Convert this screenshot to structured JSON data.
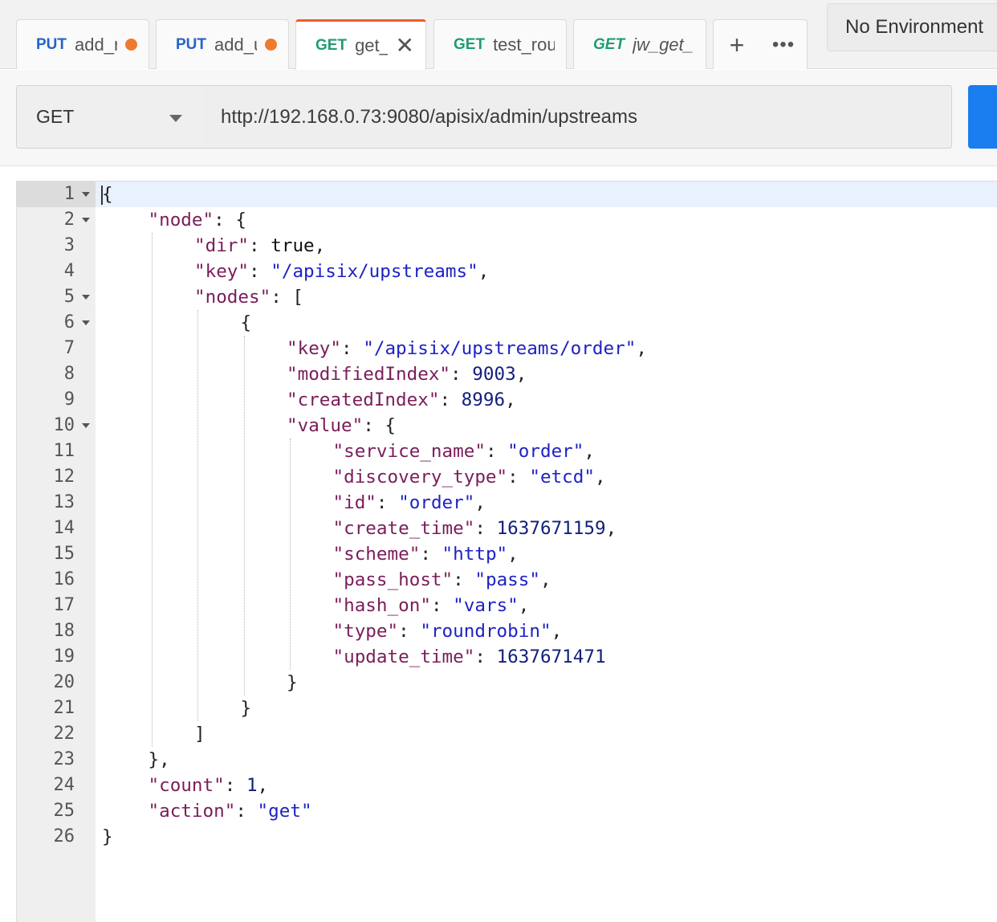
{
  "tabs": [
    {
      "method": "PUT",
      "name": "add_r",
      "unsaved": true,
      "active": false,
      "italic": false
    },
    {
      "method": "PUT",
      "name": "add_u",
      "unsaved": true,
      "active": false,
      "italic": false
    },
    {
      "method": "GET",
      "name": "get_u",
      "unsaved": false,
      "active": true,
      "italic": false
    },
    {
      "method": "GET",
      "name": "test_route",
      "unsaved": false,
      "active": false,
      "italic": false
    },
    {
      "method": "GET",
      "name": "jw_get_token",
      "unsaved": false,
      "active": false,
      "italic": true
    }
  ],
  "tab_controls": {
    "new_tab": "+",
    "more": "•••"
  },
  "environment": "No Environment",
  "request": {
    "method": "GET",
    "url": "http://192.168.0.73:9080/apisix/admin/upstreams"
  },
  "colors": {
    "accent": "#ef5b25",
    "send_button": "#1a7df0",
    "put_method": "#2563c9",
    "get_method": "#1f9d6e",
    "unsaved_dot": "#ef7a2e"
  },
  "editor": {
    "active_line": 1,
    "lines": [
      {
        "no": "1",
        "fold": true,
        "indent": 0,
        "tokens": [
          {
            "t": "p",
            "v": "{"
          }
        ]
      },
      {
        "no": "2",
        "fold": true,
        "indent": 1,
        "tokens": [
          {
            "t": "k",
            "v": "\"node\""
          },
          {
            "t": "p",
            "v": ": {"
          }
        ]
      },
      {
        "no": "3",
        "fold": false,
        "indent": 2,
        "tokens": [
          {
            "t": "k",
            "v": "\"dir\""
          },
          {
            "t": "p",
            "v": ": "
          },
          {
            "t": "b",
            "v": "true"
          },
          {
            "t": "p",
            "v": ","
          }
        ]
      },
      {
        "no": "4",
        "fold": false,
        "indent": 2,
        "tokens": [
          {
            "t": "k",
            "v": "\"key\""
          },
          {
            "t": "p",
            "v": ": "
          },
          {
            "t": "s",
            "v": "\"/apisix/upstreams\""
          },
          {
            "t": "p",
            "v": ","
          }
        ]
      },
      {
        "no": "5",
        "fold": true,
        "indent": 2,
        "tokens": [
          {
            "t": "k",
            "v": "\"nodes\""
          },
          {
            "t": "p",
            "v": ": ["
          }
        ]
      },
      {
        "no": "6",
        "fold": true,
        "indent": 3,
        "tokens": [
          {
            "t": "p",
            "v": "{"
          }
        ]
      },
      {
        "no": "7",
        "fold": false,
        "indent": 4,
        "tokens": [
          {
            "t": "k",
            "v": "\"key\""
          },
          {
            "t": "p",
            "v": ": "
          },
          {
            "t": "s",
            "v": "\"/apisix/upstreams/order\""
          },
          {
            "t": "p",
            "v": ","
          }
        ]
      },
      {
        "no": "8",
        "fold": false,
        "indent": 4,
        "tokens": [
          {
            "t": "k",
            "v": "\"modifiedIndex\""
          },
          {
            "t": "p",
            "v": ": "
          },
          {
            "t": "n",
            "v": "9003"
          },
          {
            "t": "p",
            "v": ","
          }
        ]
      },
      {
        "no": "9",
        "fold": false,
        "indent": 4,
        "tokens": [
          {
            "t": "k",
            "v": "\"createdIndex\""
          },
          {
            "t": "p",
            "v": ": "
          },
          {
            "t": "n",
            "v": "8996"
          },
          {
            "t": "p",
            "v": ","
          }
        ]
      },
      {
        "no": "10",
        "fold": true,
        "indent": 4,
        "tokens": [
          {
            "t": "k",
            "v": "\"value\""
          },
          {
            "t": "p",
            "v": ": {"
          }
        ]
      },
      {
        "no": "11",
        "fold": false,
        "indent": 5,
        "tokens": [
          {
            "t": "k",
            "v": "\"service_name\""
          },
          {
            "t": "p",
            "v": ": "
          },
          {
            "t": "s",
            "v": "\"order\""
          },
          {
            "t": "p",
            "v": ","
          }
        ]
      },
      {
        "no": "12",
        "fold": false,
        "indent": 5,
        "tokens": [
          {
            "t": "k",
            "v": "\"discovery_type\""
          },
          {
            "t": "p",
            "v": ": "
          },
          {
            "t": "s",
            "v": "\"etcd\""
          },
          {
            "t": "p",
            "v": ","
          }
        ]
      },
      {
        "no": "13",
        "fold": false,
        "indent": 5,
        "tokens": [
          {
            "t": "k",
            "v": "\"id\""
          },
          {
            "t": "p",
            "v": ": "
          },
          {
            "t": "s",
            "v": "\"order\""
          },
          {
            "t": "p",
            "v": ","
          }
        ]
      },
      {
        "no": "14",
        "fold": false,
        "indent": 5,
        "tokens": [
          {
            "t": "k",
            "v": "\"create_time\""
          },
          {
            "t": "p",
            "v": ": "
          },
          {
            "t": "n",
            "v": "1637671159"
          },
          {
            "t": "p",
            "v": ","
          }
        ]
      },
      {
        "no": "15",
        "fold": false,
        "indent": 5,
        "tokens": [
          {
            "t": "k",
            "v": "\"scheme\""
          },
          {
            "t": "p",
            "v": ": "
          },
          {
            "t": "s",
            "v": "\"http\""
          },
          {
            "t": "p",
            "v": ","
          }
        ]
      },
      {
        "no": "16",
        "fold": false,
        "indent": 5,
        "tokens": [
          {
            "t": "k",
            "v": "\"pass_host\""
          },
          {
            "t": "p",
            "v": ": "
          },
          {
            "t": "s",
            "v": "\"pass\""
          },
          {
            "t": "p",
            "v": ","
          }
        ]
      },
      {
        "no": "17",
        "fold": false,
        "indent": 5,
        "tokens": [
          {
            "t": "k",
            "v": "\"hash_on\""
          },
          {
            "t": "p",
            "v": ": "
          },
          {
            "t": "s",
            "v": "\"vars\""
          },
          {
            "t": "p",
            "v": ","
          }
        ]
      },
      {
        "no": "18",
        "fold": false,
        "indent": 5,
        "tokens": [
          {
            "t": "k",
            "v": "\"type\""
          },
          {
            "t": "p",
            "v": ": "
          },
          {
            "t": "s",
            "v": "\"roundrobin\""
          },
          {
            "t": "p",
            "v": ","
          }
        ]
      },
      {
        "no": "19",
        "fold": false,
        "indent": 5,
        "tokens": [
          {
            "t": "k",
            "v": "\"update_time\""
          },
          {
            "t": "p",
            "v": ": "
          },
          {
            "t": "n",
            "v": "1637671471"
          }
        ]
      },
      {
        "no": "20",
        "fold": false,
        "indent": 4,
        "tokens": [
          {
            "t": "p",
            "v": "}"
          }
        ]
      },
      {
        "no": "21",
        "fold": false,
        "indent": 3,
        "tokens": [
          {
            "t": "p",
            "v": "}"
          }
        ]
      },
      {
        "no": "22",
        "fold": false,
        "indent": 2,
        "tokens": [
          {
            "t": "p",
            "v": "]"
          }
        ]
      },
      {
        "no": "23",
        "fold": false,
        "indent": 1,
        "tokens": [
          {
            "t": "p",
            "v": "},"
          }
        ]
      },
      {
        "no": "24",
        "fold": false,
        "indent": 1,
        "tokens": [
          {
            "t": "k",
            "v": "\"count\""
          },
          {
            "t": "p",
            "v": ": "
          },
          {
            "t": "n",
            "v": "1"
          },
          {
            "t": "p",
            "v": ","
          }
        ]
      },
      {
        "no": "25",
        "fold": false,
        "indent": 1,
        "tokens": [
          {
            "t": "k",
            "v": "\"action\""
          },
          {
            "t": "p",
            "v": ": "
          },
          {
            "t": "s",
            "v": "\"get\""
          }
        ]
      },
      {
        "no": "26",
        "fold": false,
        "indent": 0,
        "tokens": [
          {
            "t": "p",
            "v": "}"
          }
        ]
      }
    ]
  }
}
